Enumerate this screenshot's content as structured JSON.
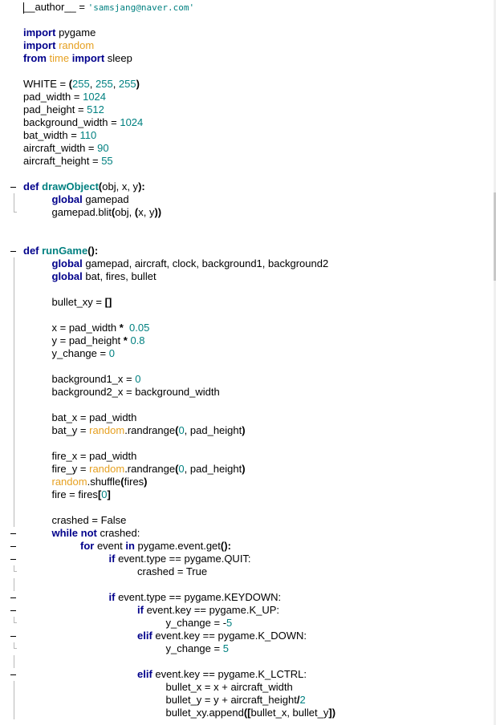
{
  "editor": {
    "language": "python",
    "colors": {
      "keyword": "#00008b",
      "number": "#008080",
      "module": "#e6a020",
      "function": "#008080",
      "string": "#008080",
      "default": "#000000"
    },
    "lines": [
      {
        "fold": "none",
        "indent": 0,
        "tokens": [
          {
            "t": "plain",
            "v": "__author__ = "
          },
          {
            "t": "str",
            "v": "'samsjang@naver.com'"
          }
        ]
      },
      {
        "fold": "none",
        "indent": 0,
        "tokens": []
      },
      {
        "fold": "none",
        "indent": 0,
        "tokens": [
          {
            "t": "kw",
            "v": "import"
          },
          {
            "t": "plain",
            "v": " pygame"
          }
        ]
      },
      {
        "fold": "none",
        "indent": 0,
        "tokens": [
          {
            "t": "kw",
            "v": "import"
          },
          {
            "t": "plain",
            "v": " "
          },
          {
            "t": "mod",
            "v": "random"
          }
        ]
      },
      {
        "fold": "none",
        "indent": 0,
        "tokens": [
          {
            "t": "kw",
            "v": "from"
          },
          {
            "t": "plain",
            "v": " "
          },
          {
            "t": "mod",
            "v": "time"
          },
          {
            "t": "plain",
            "v": " "
          },
          {
            "t": "kw",
            "v": "import"
          },
          {
            "t": "plain",
            "v": " sleep"
          }
        ]
      },
      {
        "fold": "none",
        "indent": 0,
        "tokens": []
      },
      {
        "fold": "none",
        "indent": 0,
        "tokens": [
          {
            "t": "plain",
            "v": "WHITE = "
          },
          {
            "t": "op",
            "v": "("
          },
          {
            "t": "num",
            "v": "255"
          },
          {
            "t": "plain",
            "v": ", "
          },
          {
            "t": "num",
            "v": "255"
          },
          {
            "t": "plain",
            "v": ", "
          },
          {
            "t": "num",
            "v": "255"
          },
          {
            "t": "op",
            "v": ")"
          }
        ]
      },
      {
        "fold": "none",
        "indent": 0,
        "tokens": [
          {
            "t": "plain",
            "v": "pad_width = "
          },
          {
            "t": "num",
            "v": "1024"
          }
        ]
      },
      {
        "fold": "none",
        "indent": 0,
        "tokens": [
          {
            "t": "plain",
            "v": "pad_height = "
          },
          {
            "t": "num",
            "v": "512"
          }
        ]
      },
      {
        "fold": "none",
        "indent": 0,
        "tokens": [
          {
            "t": "plain",
            "v": "background_width = "
          },
          {
            "t": "num",
            "v": "1024"
          }
        ]
      },
      {
        "fold": "none",
        "indent": 0,
        "tokens": [
          {
            "t": "plain",
            "v": "bat_width = "
          },
          {
            "t": "num",
            "v": "110"
          }
        ]
      },
      {
        "fold": "none",
        "indent": 0,
        "tokens": [
          {
            "t": "plain",
            "v": "aircraft_width = "
          },
          {
            "t": "num",
            "v": "90"
          }
        ]
      },
      {
        "fold": "none",
        "indent": 0,
        "tokens": [
          {
            "t": "plain",
            "v": "aircraft_height = "
          },
          {
            "t": "num",
            "v": "55"
          }
        ]
      },
      {
        "fold": "none",
        "indent": 0,
        "tokens": []
      },
      {
        "fold": "collapse",
        "indent": 0,
        "tokens": [
          {
            "t": "kw",
            "v": "def"
          },
          {
            "t": "plain",
            "v": " "
          },
          {
            "t": "fn",
            "v": "drawObject"
          },
          {
            "t": "op",
            "v": "("
          },
          {
            "t": "plain",
            "v": "obj, x, y"
          },
          {
            "t": "op",
            "v": "):"
          }
        ]
      },
      {
        "fold": "bar",
        "indent": 1,
        "tokens": [
          {
            "t": "kw",
            "v": "global"
          },
          {
            "t": "plain",
            "v": " gamepad"
          }
        ]
      },
      {
        "fold": "end",
        "indent": 1,
        "tokens": [
          {
            "t": "plain",
            "v": "gamepad.blit"
          },
          {
            "t": "op",
            "v": "("
          },
          {
            "t": "plain",
            "v": "obj, "
          },
          {
            "t": "op",
            "v": "("
          },
          {
            "t": "plain",
            "v": "x, y"
          },
          {
            "t": "op",
            "v": "))"
          }
        ]
      },
      {
        "fold": "none",
        "indent": 0,
        "tokens": []
      },
      {
        "fold": "none",
        "indent": 0,
        "tokens": []
      },
      {
        "fold": "collapse",
        "indent": 0,
        "tokens": [
          {
            "t": "kw",
            "v": "def"
          },
          {
            "t": "plain",
            "v": " "
          },
          {
            "t": "fn",
            "v": "runGame"
          },
          {
            "t": "op",
            "v": "():"
          }
        ]
      },
      {
        "fold": "bar",
        "indent": 1,
        "tokens": [
          {
            "t": "kw",
            "v": "global"
          },
          {
            "t": "plain",
            "v": " gamepad, aircraft, clock, background1, background2"
          }
        ]
      },
      {
        "fold": "bar",
        "indent": 1,
        "tokens": [
          {
            "t": "kw",
            "v": "global"
          },
          {
            "t": "plain",
            "v": " bat, fires, bullet"
          }
        ]
      },
      {
        "fold": "bar",
        "indent": 1,
        "tokens": []
      },
      {
        "fold": "bar",
        "indent": 1,
        "tokens": [
          {
            "t": "plain",
            "v": "bullet_xy = "
          },
          {
            "t": "op",
            "v": "[]"
          }
        ]
      },
      {
        "fold": "bar",
        "indent": 1,
        "tokens": []
      },
      {
        "fold": "bar",
        "indent": 1,
        "tokens": [
          {
            "t": "plain",
            "v": "x = pad_width "
          },
          {
            "t": "op",
            "v": "*"
          },
          {
            "t": "plain",
            "v": "  "
          },
          {
            "t": "num",
            "v": "0.05"
          }
        ]
      },
      {
        "fold": "bar",
        "indent": 1,
        "tokens": [
          {
            "t": "plain",
            "v": "y = pad_height "
          },
          {
            "t": "op",
            "v": "*"
          },
          {
            "t": "plain",
            "v": " "
          },
          {
            "t": "num",
            "v": "0.8"
          }
        ]
      },
      {
        "fold": "bar",
        "indent": 1,
        "tokens": [
          {
            "t": "plain",
            "v": "y_change = "
          },
          {
            "t": "num",
            "v": "0"
          }
        ]
      },
      {
        "fold": "bar",
        "indent": 1,
        "tokens": []
      },
      {
        "fold": "bar",
        "indent": 1,
        "tokens": [
          {
            "t": "plain",
            "v": "background1_x = "
          },
          {
            "t": "num",
            "v": "0"
          }
        ]
      },
      {
        "fold": "bar",
        "indent": 1,
        "tokens": [
          {
            "t": "plain",
            "v": "background2_x = background_width"
          }
        ]
      },
      {
        "fold": "bar",
        "indent": 1,
        "tokens": []
      },
      {
        "fold": "bar",
        "indent": 1,
        "tokens": [
          {
            "t": "plain",
            "v": "bat_x = pad_width"
          }
        ]
      },
      {
        "fold": "bar",
        "indent": 1,
        "tokens": [
          {
            "t": "plain",
            "v": "bat_y = "
          },
          {
            "t": "mod",
            "v": "random"
          },
          {
            "t": "plain",
            "v": ".randrange"
          },
          {
            "t": "op",
            "v": "("
          },
          {
            "t": "num",
            "v": "0"
          },
          {
            "t": "plain",
            "v": ", pad_height"
          },
          {
            "t": "op",
            "v": ")"
          }
        ]
      },
      {
        "fold": "bar",
        "indent": 1,
        "tokens": []
      },
      {
        "fold": "bar",
        "indent": 1,
        "tokens": [
          {
            "t": "plain",
            "v": "fire_x = pad_width"
          }
        ]
      },
      {
        "fold": "bar",
        "indent": 1,
        "tokens": [
          {
            "t": "plain",
            "v": "fire_y = "
          },
          {
            "t": "mod",
            "v": "random"
          },
          {
            "t": "plain",
            "v": ".randrange"
          },
          {
            "t": "op",
            "v": "("
          },
          {
            "t": "num",
            "v": "0"
          },
          {
            "t": "plain",
            "v": ", pad_height"
          },
          {
            "t": "op",
            "v": ")"
          }
        ]
      },
      {
        "fold": "bar",
        "indent": 1,
        "tokens": [
          {
            "t": "mod",
            "v": "random"
          },
          {
            "t": "plain",
            "v": ".shuffle"
          },
          {
            "t": "op",
            "v": "("
          },
          {
            "t": "plain",
            "v": "fires"
          },
          {
            "t": "op",
            "v": ")"
          }
        ]
      },
      {
        "fold": "bar",
        "indent": 1,
        "tokens": [
          {
            "t": "plain",
            "v": "fire = fires"
          },
          {
            "t": "op",
            "v": "["
          },
          {
            "t": "num",
            "v": "0"
          },
          {
            "t": "op",
            "v": "]"
          }
        ]
      },
      {
        "fold": "bar",
        "indent": 1,
        "tokens": []
      },
      {
        "fold": "bar",
        "indent": 1,
        "tokens": [
          {
            "t": "plain",
            "v": "crashed = False"
          }
        ]
      },
      {
        "fold": "collapse",
        "indent": 1,
        "tokens": [
          {
            "t": "kw",
            "v": "while"
          },
          {
            "t": "plain",
            "v": " "
          },
          {
            "t": "kw",
            "v": "not"
          },
          {
            "t": "plain",
            "v": " crashed:"
          }
        ]
      },
      {
        "fold": "collapse",
        "indent": 2,
        "tokens": [
          {
            "t": "kw",
            "v": "for"
          },
          {
            "t": "plain",
            "v": " event "
          },
          {
            "t": "kw",
            "v": "in"
          },
          {
            "t": "plain",
            "v": " pygame.event.get"
          },
          {
            "t": "op",
            "v": "():"
          }
        ]
      },
      {
        "fold": "collapse",
        "indent": 3,
        "tokens": [
          {
            "t": "kw",
            "v": "if"
          },
          {
            "t": "plain",
            "v": " event.type == pygame.QUIT:"
          }
        ]
      },
      {
        "fold": "end",
        "indent": 4,
        "tokens": [
          {
            "t": "plain",
            "v": "crashed = True"
          }
        ]
      },
      {
        "fold": "bar",
        "indent": 0,
        "tokens": []
      },
      {
        "fold": "collapse",
        "indent": 3,
        "tokens": [
          {
            "t": "kw",
            "v": "if"
          },
          {
            "t": "plain",
            "v": " event.type == pygame.KEYDOWN:"
          }
        ]
      },
      {
        "fold": "collapse",
        "indent": 4,
        "tokens": [
          {
            "t": "kw",
            "v": "if"
          },
          {
            "t": "plain",
            "v": " event.key == pygame.K_UP:"
          }
        ]
      },
      {
        "fold": "end",
        "indent": 5,
        "tokens": [
          {
            "t": "plain",
            "v": "y_change = -"
          },
          {
            "t": "num",
            "v": "5"
          }
        ]
      },
      {
        "fold": "collapse",
        "indent": 4,
        "tokens": [
          {
            "t": "kw",
            "v": "elif"
          },
          {
            "t": "plain",
            "v": " event.key == pygame.K_DOWN:"
          }
        ]
      },
      {
        "fold": "end",
        "indent": 5,
        "tokens": [
          {
            "t": "plain",
            "v": "y_change = "
          },
          {
            "t": "num",
            "v": "5"
          }
        ]
      },
      {
        "fold": "bar",
        "indent": 0,
        "tokens": []
      },
      {
        "fold": "collapse",
        "indent": 4,
        "tokens": [
          {
            "t": "kw",
            "v": "elif"
          },
          {
            "t": "plain",
            "v": " event.key == pygame.K_LCTRL:"
          }
        ]
      },
      {
        "fold": "bar",
        "indent": 5,
        "tokens": [
          {
            "t": "plain",
            "v": "bullet_x = x + aircraft_width"
          }
        ]
      },
      {
        "fold": "bar",
        "indent": 5,
        "tokens": [
          {
            "t": "plain",
            "v": "bullet_y = y + aircraft_height"
          },
          {
            "t": "op",
            "v": "/"
          },
          {
            "t": "num",
            "v": "2"
          }
        ]
      },
      {
        "fold": "bar",
        "indent": 5,
        "tokens": [
          {
            "t": "plain",
            "v": "bullet_xy.append"
          },
          {
            "t": "op",
            "v": "(["
          },
          {
            "t": "plain",
            "v": "bullet_x, bullet_y"
          },
          {
            "t": "op",
            "v": "])"
          }
        ]
      }
    ]
  }
}
